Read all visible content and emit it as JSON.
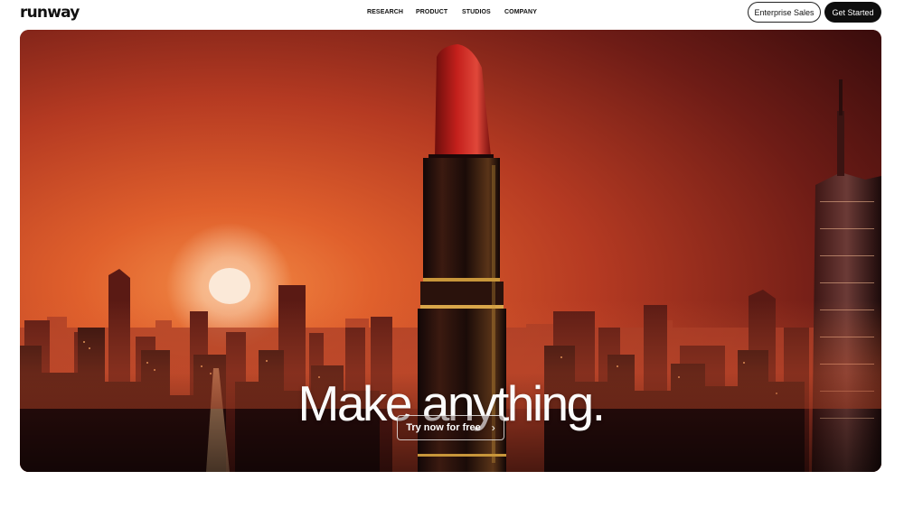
{
  "header": {
    "logo": "runway",
    "nav": [
      {
        "label": "RESEARCH"
      },
      {
        "label": "PRODUCT"
      },
      {
        "label": "STUDIOS"
      },
      {
        "label": "COMPANY"
      }
    ],
    "enterprise_label": "Enterprise Sales",
    "get_started_label": "Get Started"
  },
  "hero": {
    "headline": "Make anything.",
    "cta_label": "Try now for free",
    "cta_icon": "chevron-right-icon",
    "image": "lipstick-over-city-skyline-at-sunset"
  },
  "colors": {
    "sky_top": "#3a0c0c",
    "sky_glow": "#e8682e",
    "sun": "#f9eadb",
    "buildings": "#2a0d0c",
    "lipstick_tip": "#c4201c",
    "gold": "#c8963a"
  }
}
